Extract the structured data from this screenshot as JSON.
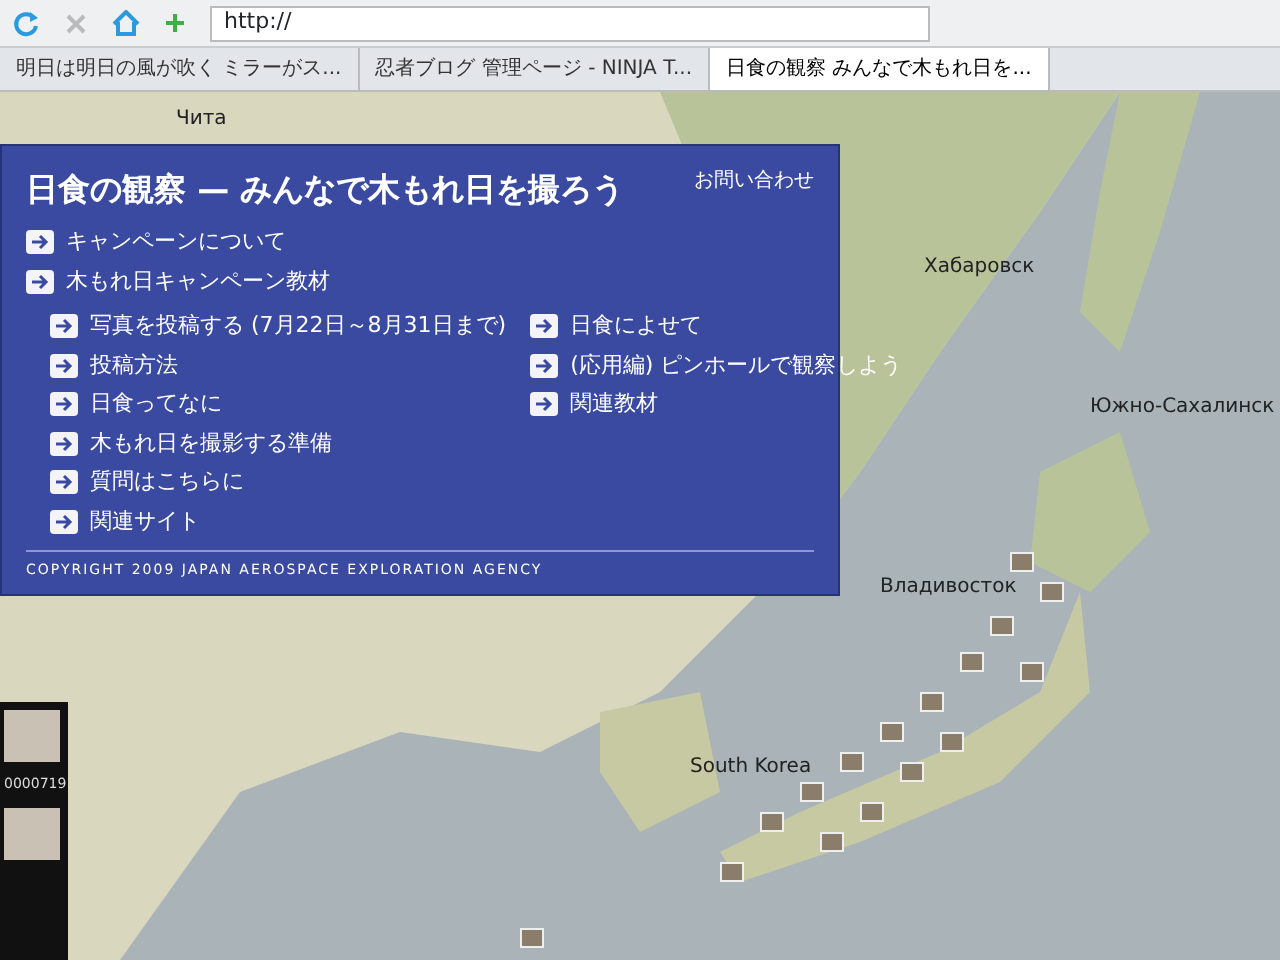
{
  "browser": {
    "address": "http://",
    "tabs": [
      {
        "title": "明日は明日の風が吹く ミラーがス...",
        "selected": false
      },
      {
        "title": "忍者ブログ 管理ページ - NINJA T...",
        "selected": false
      },
      {
        "title": "日食の観察 みんなで木もれ日を...",
        "selected": true
      }
    ]
  },
  "map": {
    "labels": [
      "Чита",
      "Хабаровск",
      "Южно-Сахалинск",
      "Владивосток",
      "South Korea"
    ]
  },
  "sidebar": {
    "captions": [
      "0000719"
    ]
  },
  "panel": {
    "title": "日食の観察 — みんなで木もれ日を撮ろう",
    "contact": "お問い合わせ",
    "main_links": [
      "キャンペーンについて",
      "木もれ日キャンペーン教材"
    ],
    "left_links": [
      "写真を投稿する (7月22日～8月31日まで)",
      "投稿方法",
      "日食ってなに",
      "木もれ日を撮影する準備",
      "質問はこちらに",
      "関連サイト"
    ],
    "right_links": [
      "日食によせて",
      "(応用編) ピンホールで観察しよう",
      "関連教材"
    ],
    "copyright": "COPYRIGHT 2009 JAPAN AEROSPACE EXPLORATION AGENCY"
  }
}
